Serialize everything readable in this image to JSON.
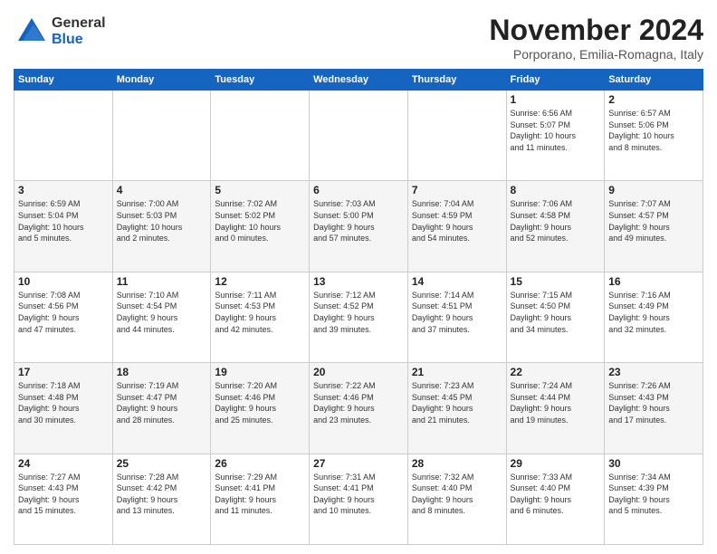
{
  "header": {
    "logo_general": "General",
    "logo_blue": "Blue",
    "month_title": "November 2024",
    "location": "Porporano, Emilia-Romagna, Italy"
  },
  "weekdays": [
    "Sunday",
    "Monday",
    "Tuesday",
    "Wednesday",
    "Thursday",
    "Friday",
    "Saturday"
  ],
  "weeks": [
    [
      {
        "day": "",
        "info": ""
      },
      {
        "day": "",
        "info": ""
      },
      {
        "day": "",
        "info": ""
      },
      {
        "day": "",
        "info": ""
      },
      {
        "day": "",
        "info": ""
      },
      {
        "day": "1",
        "info": "Sunrise: 6:56 AM\nSunset: 5:07 PM\nDaylight: 10 hours\nand 11 minutes."
      },
      {
        "day": "2",
        "info": "Sunrise: 6:57 AM\nSunset: 5:06 PM\nDaylight: 10 hours\nand 8 minutes."
      }
    ],
    [
      {
        "day": "3",
        "info": "Sunrise: 6:59 AM\nSunset: 5:04 PM\nDaylight: 10 hours\nand 5 minutes."
      },
      {
        "day": "4",
        "info": "Sunrise: 7:00 AM\nSunset: 5:03 PM\nDaylight: 10 hours\nand 2 minutes."
      },
      {
        "day": "5",
        "info": "Sunrise: 7:02 AM\nSunset: 5:02 PM\nDaylight: 10 hours\nand 0 minutes."
      },
      {
        "day": "6",
        "info": "Sunrise: 7:03 AM\nSunset: 5:00 PM\nDaylight: 9 hours\nand 57 minutes."
      },
      {
        "day": "7",
        "info": "Sunrise: 7:04 AM\nSunset: 4:59 PM\nDaylight: 9 hours\nand 54 minutes."
      },
      {
        "day": "8",
        "info": "Sunrise: 7:06 AM\nSunset: 4:58 PM\nDaylight: 9 hours\nand 52 minutes."
      },
      {
        "day": "9",
        "info": "Sunrise: 7:07 AM\nSunset: 4:57 PM\nDaylight: 9 hours\nand 49 minutes."
      }
    ],
    [
      {
        "day": "10",
        "info": "Sunrise: 7:08 AM\nSunset: 4:56 PM\nDaylight: 9 hours\nand 47 minutes."
      },
      {
        "day": "11",
        "info": "Sunrise: 7:10 AM\nSunset: 4:54 PM\nDaylight: 9 hours\nand 44 minutes."
      },
      {
        "day": "12",
        "info": "Sunrise: 7:11 AM\nSunset: 4:53 PM\nDaylight: 9 hours\nand 42 minutes."
      },
      {
        "day": "13",
        "info": "Sunrise: 7:12 AM\nSunset: 4:52 PM\nDaylight: 9 hours\nand 39 minutes."
      },
      {
        "day": "14",
        "info": "Sunrise: 7:14 AM\nSunset: 4:51 PM\nDaylight: 9 hours\nand 37 minutes."
      },
      {
        "day": "15",
        "info": "Sunrise: 7:15 AM\nSunset: 4:50 PM\nDaylight: 9 hours\nand 34 minutes."
      },
      {
        "day": "16",
        "info": "Sunrise: 7:16 AM\nSunset: 4:49 PM\nDaylight: 9 hours\nand 32 minutes."
      }
    ],
    [
      {
        "day": "17",
        "info": "Sunrise: 7:18 AM\nSunset: 4:48 PM\nDaylight: 9 hours\nand 30 minutes."
      },
      {
        "day": "18",
        "info": "Sunrise: 7:19 AM\nSunset: 4:47 PM\nDaylight: 9 hours\nand 28 minutes."
      },
      {
        "day": "19",
        "info": "Sunrise: 7:20 AM\nSunset: 4:46 PM\nDaylight: 9 hours\nand 25 minutes."
      },
      {
        "day": "20",
        "info": "Sunrise: 7:22 AM\nSunset: 4:46 PM\nDaylight: 9 hours\nand 23 minutes."
      },
      {
        "day": "21",
        "info": "Sunrise: 7:23 AM\nSunset: 4:45 PM\nDaylight: 9 hours\nand 21 minutes."
      },
      {
        "day": "22",
        "info": "Sunrise: 7:24 AM\nSunset: 4:44 PM\nDaylight: 9 hours\nand 19 minutes."
      },
      {
        "day": "23",
        "info": "Sunrise: 7:26 AM\nSunset: 4:43 PM\nDaylight: 9 hours\nand 17 minutes."
      }
    ],
    [
      {
        "day": "24",
        "info": "Sunrise: 7:27 AM\nSunset: 4:43 PM\nDaylight: 9 hours\nand 15 minutes."
      },
      {
        "day": "25",
        "info": "Sunrise: 7:28 AM\nSunset: 4:42 PM\nDaylight: 9 hours\nand 13 minutes."
      },
      {
        "day": "26",
        "info": "Sunrise: 7:29 AM\nSunset: 4:41 PM\nDaylight: 9 hours\nand 11 minutes."
      },
      {
        "day": "27",
        "info": "Sunrise: 7:31 AM\nSunset: 4:41 PM\nDaylight: 9 hours\nand 10 minutes."
      },
      {
        "day": "28",
        "info": "Sunrise: 7:32 AM\nSunset: 4:40 PM\nDaylight: 9 hours\nand 8 minutes."
      },
      {
        "day": "29",
        "info": "Sunrise: 7:33 AM\nSunset: 4:40 PM\nDaylight: 9 hours\nand 6 minutes."
      },
      {
        "day": "30",
        "info": "Sunrise: 7:34 AM\nSunset: 4:39 PM\nDaylight: 9 hours\nand 5 minutes."
      }
    ]
  ]
}
